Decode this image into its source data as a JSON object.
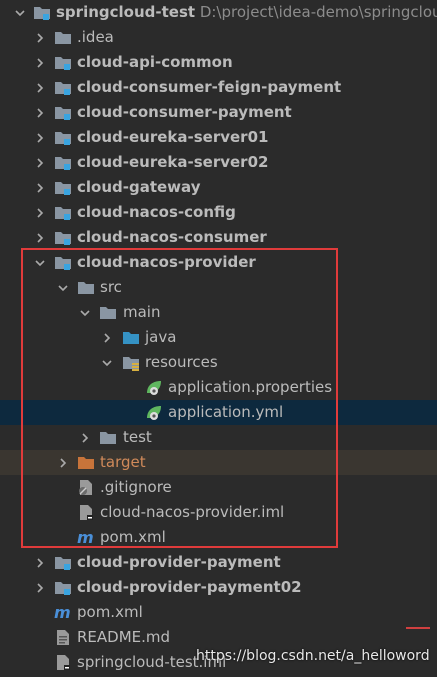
{
  "root": {
    "name": "springcloud-test",
    "path": "D:\\project\\idea-demo\\springclou"
  },
  "modules": [
    {
      "label": ".idea"
    },
    {
      "label": "cloud-api-common"
    },
    {
      "label": "cloud-consumer-feign-payment"
    },
    {
      "label": "cloud-consumer-payment"
    },
    {
      "label": "cloud-eureka-server01"
    },
    {
      "label": "cloud-eureka-server02"
    },
    {
      "label": "cloud-gateway"
    },
    {
      "label": "cloud-nacos-config"
    },
    {
      "label": "cloud-nacos-consumer"
    }
  ],
  "provider": {
    "label": "cloud-nacos-provider",
    "src": "src",
    "main": "main",
    "java": "java",
    "resources": "resources",
    "app_properties": "application.properties",
    "app_yml": "application.yml",
    "test": "test",
    "target": "target",
    "gitignore": ".gitignore",
    "iml": "cloud-nacos-provider.iml",
    "pom": "pom.xml"
  },
  "modules_after": [
    {
      "label": "cloud-provider-payment"
    },
    {
      "label": "cloud-provider-payment02"
    }
  ],
  "root_files": {
    "pom": "pom.xml",
    "readme": "README.md",
    "iml": "springcloud-test.iml"
  },
  "watermark": "https://blog.csdn.net/a_helloword",
  "colors": {
    "background": "#2b2b2b",
    "selection": "#0d293e",
    "excluded": "#3a3630",
    "highlight_box": "#e03b3b",
    "folder": "#8a96a3",
    "module_badge": "#3aa4e0",
    "source_folder": "#3592c4",
    "target_folder": "#c8743a"
  }
}
